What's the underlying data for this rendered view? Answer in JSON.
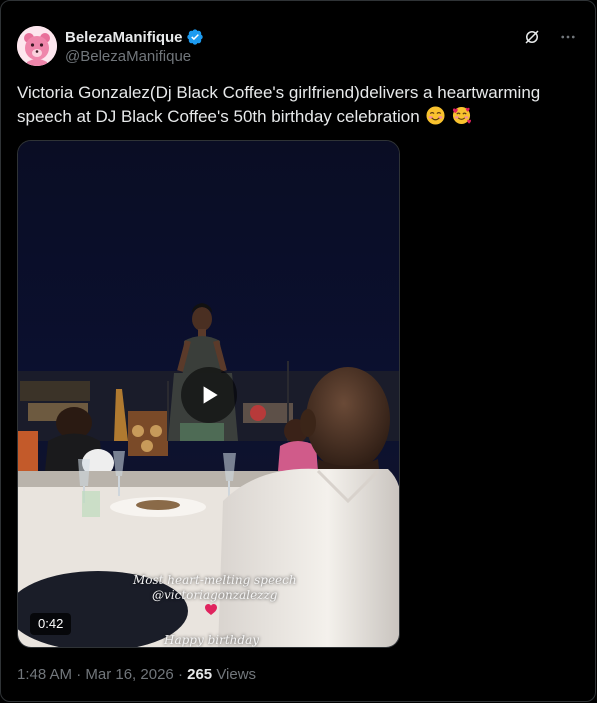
{
  "tweet": {
    "author_name": "BelezaManifique",
    "author_handle": "@BelezaManifique",
    "verified": true,
    "text": "Victoria Gonzalez(Dj Black Coffee's girlfriend)delivers a heartwarming speech at DJ Black Coffee's 50th birthday celebration",
    "emojis": [
      "smiling-face-emoji",
      "smiling-face-with-hearts-emoji"
    ],
    "timestamp": "1:48 AM · Mar 16, 2026",
    "views_count": "265",
    "views_label": "Views"
  },
  "media": {
    "duration": "0:42",
    "overlay_caption_1": "Most heart-melting speech",
    "overlay_caption_2": "@victoriagonzalezzg",
    "overlay_caption_3": "Happy birthday"
  },
  "icons": {
    "grok": "grok-icon",
    "more": "more-icon",
    "play": "play-icon",
    "verified": "verified-badge-icon"
  },
  "colors": {
    "background": "#000000",
    "primary_text": "#e7e9ea",
    "secondary_text": "#71767b",
    "verified_blue": "#1d9bf0",
    "border": "#2f3336"
  }
}
